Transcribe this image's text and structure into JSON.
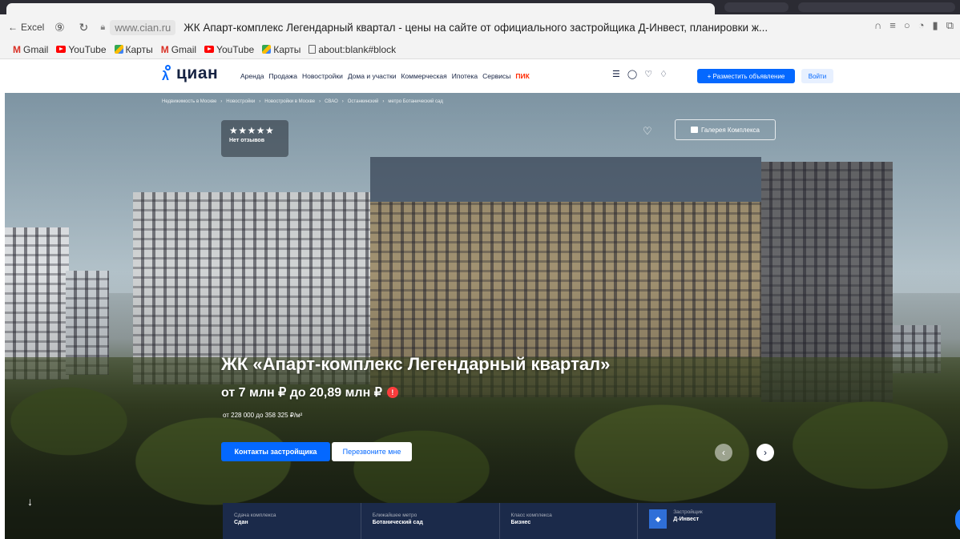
{
  "browser": {
    "back_label": "Excel",
    "domain": "www.cian.ru",
    "page_title": "ЖК Апарт-комплекс Легендарный квартал - цены на сайте от официального застройщика Д-Инвест, планировки ж..."
  },
  "bookmarks": [
    {
      "label": "Gmail",
      "icon": "gmail-icon"
    },
    {
      "label": "YouTube",
      "icon": "youtube-icon"
    },
    {
      "label": "Карты",
      "icon": "maps-icon"
    },
    {
      "label": "Gmail",
      "icon": "gmail-icon"
    },
    {
      "label": "YouTube",
      "icon": "youtube-icon"
    },
    {
      "label": "Карты",
      "icon": "maps-icon"
    },
    {
      "label": "about:blank#block",
      "icon": "page-icon"
    }
  ],
  "site": {
    "logo": "циан",
    "nav": [
      "Аренда",
      "Продажа",
      "Новостройки",
      "Дома и участки",
      "Коммерческая",
      "Ипотека",
      "Сервисы",
      "ПИК"
    ],
    "post_button": "+ Разместить объявление",
    "login_button": "Войти"
  },
  "breadcrumbs": [
    "Недвижимость в Москве",
    "Новостройки",
    "Новостройки в Москве",
    "СВАО",
    "Останкинский",
    "метро Ботанический сад"
  ],
  "hero": {
    "stars": "★★★★★",
    "reviews": "Нет отзывов",
    "gallery_button": "Галерея Комплекса",
    "title": "ЖК «Апарт-комплекс Легендарный квартал»",
    "price": "от 7 млн ₽ до 20,89 млн ₽",
    "price_per_sqm": "от 228 000 до 358 325 ₽/м²",
    "contacts_button": "Контакты застройщика",
    "callback_button": "Перезвоните мне"
  },
  "info": [
    {
      "key": "Сдача комплекса",
      "value": "Сдан"
    },
    {
      "key": "Ближайшее метро",
      "value": "Ботанический сад"
    },
    {
      "key": "Класс комплекса",
      "value": "Бизнес"
    },
    {
      "key": "Застройщик",
      "value": "Д-Инвест"
    }
  ],
  "colors": {
    "brand": "#0468ff",
    "dark": "#152242",
    "pik": "#ff2a00"
  }
}
